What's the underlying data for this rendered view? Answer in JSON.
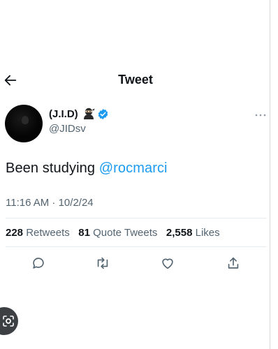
{
  "header": {
    "title": "Tweet"
  },
  "author": {
    "display_name": "(J.I.D)",
    "handle": "@JIDsv"
  },
  "tweet": {
    "text_prefix": "Been studying ",
    "mention": "@rocmarci",
    "timestamp": "11:16 AM · 10/2/24"
  },
  "stats": {
    "retweets_count": "228",
    "retweets_label": "Retweets",
    "quotes_count": "81",
    "quotes_label": "Quote Tweets",
    "likes_count": "2,558",
    "likes_label": "Likes"
  },
  "icons": {
    "back": "arrow-left-icon",
    "verified": "verified-badge-icon",
    "emoji": "ninja-icon",
    "more": "more-icon",
    "reply": "reply-icon",
    "retweet": "retweet-icon",
    "like": "heart-icon",
    "share": "share-icon",
    "lens": "lens-icon"
  },
  "colors": {
    "accent": "#1d9bf0",
    "text": "#0f1419",
    "muted": "#536471"
  }
}
